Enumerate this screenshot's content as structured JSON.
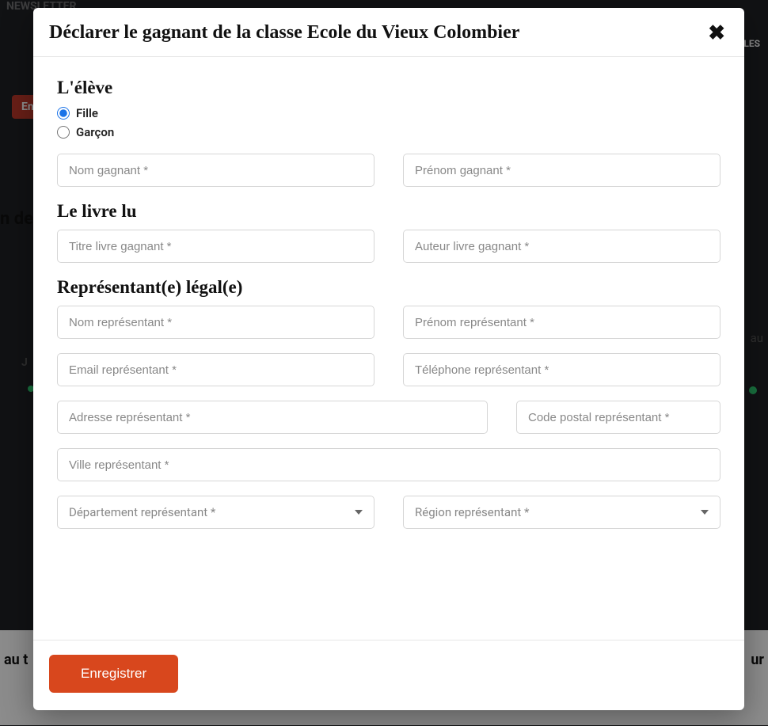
{
  "bg": {
    "top": "NEWSLETTER",
    "les": "LES",
    "en": "En",
    "de": "n de",
    "au": "au",
    "j": "J",
    "aut": "au t",
    "ur": "ur"
  },
  "modal": {
    "title": "Déclarer le gagnant de la classe Ecole du Vieux Colombier",
    "save_label": "Enregistrer"
  },
  "student": {
    "heading": "L'élève",
    "radio_girl": "Fille",
    "radio_boy": "Garçon",
    "lastname_ph": "Nom gagnant *",
    "firstname_ph": "Prénom gagnant *"
  },
  "book": {
    "heading": "Le livre lu",
    "title_ph": "Titre livre gagnant *",
    "author_ph": "Auteur livre gagnant *"
  },
  "rep": {
    "heading": "Représentant(e) légal(e)",
    "lastname_ph": "Nom représentant *",
    "firstname_ph": "Prénom représentant *",
    "email_ph": "Email représentant *",
    "phone_ph": "Téléphone représentant *",
    "address_ph": "Adresse représentant *",
    "postal_ph": "Code postal représentant *",
    "city_ph": "Ville représentant *",
    "dept_ph": "Département représentant *",
    "region_ph": "Région représentant *"
  }
}
